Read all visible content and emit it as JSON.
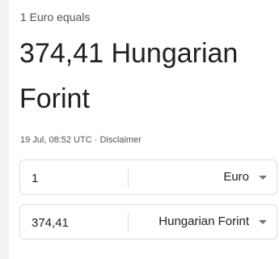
{
  "converter": {
    "subtitle": "1 Euro equals",
    "result_value": "374,41",
    "result_currency": "Hungarian Forint",
    "timestamp": "19 Jul, 08:52 UTC",
    "separator": "·",
    "disclaimer": "Disclaimer",
    "from": {
      "amount": "1",
      "currency": "Euro"
    },
    "to": {
      "amount": "374,41",
      "currency": "Hungarian Forint"
    }
  }
}
